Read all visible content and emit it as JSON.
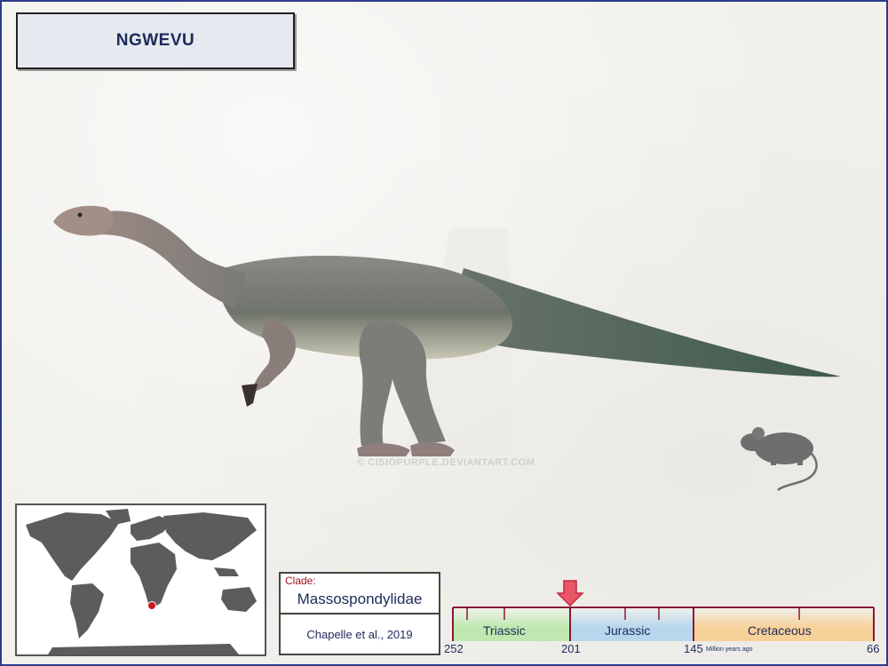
{
  "title": "NGWEVU",
  "watermark": "© CISIOPURPLE.DEVIANTART.COM",
  "clade": {
    "label": "Clade:",
    "name": "Massospondylidae"
  },
  "citation": "Chapelle et al., 2019",
  "timeline": {
    "periods": [
      {
        "name": "Triassic",
        "color": "#bfe8b0"
      },
      {
        "name": "Jurassic",
        "color": "#b7d7ec"
      },
      {
        "name": "Cretaceous",
        "color": "#f6d19a"
      }
    ],
    "ticks": [
      "252",
      "201",
      "145",
      "66"
    ],
    "unit": "Million years ago",
    "marker_color": "#e8566a"
  },
  "colors": {
    "border": "#2d3a8c",
    "tick": "#8a1535",
    "text": "#1d2a5a",
    "location_dot": "#c8171d"
  },
  "icons": [
    "dinosaur-silhouette",
    "mouse-silhouette",
    "world-map",
    "location-dot",
    "arrow-down-icon"
  ]
}
